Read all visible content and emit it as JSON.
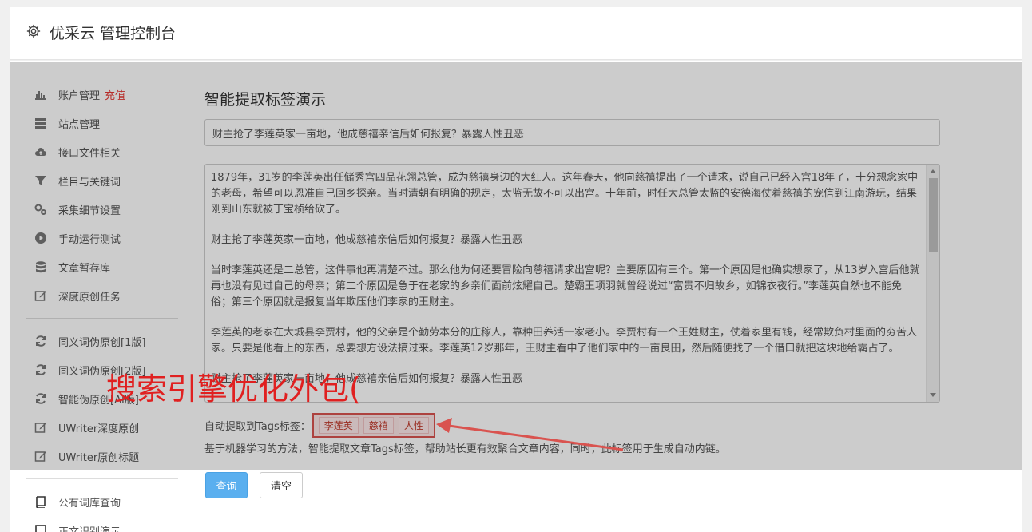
{
  "header": {
    "title": "优采云 管理控制台",
    "icon": "gear-icon"
  },
  "sidebar": {
    "items": [
      {
        "label": "账户管理",
        "badge": "充值",
        "icon": "bar-chart-icon"
      },
      {
        "label": "站点管理",
        "icon": "list-icon"
      },
      {
        "label": "接口文件相关",
        "icon": "cloud-upload-icon"
      },
      {
        "label": "栏目与关键词",
        "icon": "filter-icon"
      },
      {
        "label": "采集细节设置",
        "icon": "gears-icon"
      },
      {
        "label": "手动运行测试",
        "icon": "play-circle-icon"
      },
      {
        "label": "文章暂存库",
        "icon": "database-icon"
      },
      {
        "label": "深度原创任务",
        "icon": "edit-icon"
      },
      {
        "label": "同义词伪原创[1版]",
        "icon": "refresh-icon"
      },
      {
        "label": "同义词伪原创[2版]",
        "icon": "refresh-icon"
      },
      {
        "label": "智能伪原创[AI版]",
        "icon": "refresh-icon"
      },
      {
        "label": "UWriter深度原创",
        "icon": "edit-icon"
      },
      {
        "label": "UWriter原创标题",
        "icon": "edit-icon"
      },
      {
        "label": "公有词库查询",
        "icon": "book-icon"
      },
      {
        "label": "正文识别演示",
        "icon": "square-icon"
      }
    ]
  },
  "main": {
    "title": "智能提取标签演示",
    "input_value": "财主抢了李莲英家一亩地，他成慈禧亲信后如何报复？暴露人性丑恶",
    "paragraphs": [
      "1879年，31岁的李莲英出任储秀宫四品花翎总管，成为慈禧身边的大红人。这年春天，他向慈禧提出了一个请求，说自己已经入宫18年了，十分想念家中的老母，希望可以恩准自己回乡探亲。当时清朝有明确的规定，太监无故不可以出宫。十年前，时任大总管太监的安德海仗着慈禧的宠信到江南游玩，结果刚到山东就被丁宝桢给砍了。",
      "财主抢了李莲英家一亩地，他成慈禧亲信后如何报复？暴露人性丑恶",
      "当时李莲英还是二总管，这件事他再清楚不过。那么他为何还要冒险向慈禧请求出宫呢？主要原因有三个。第一个原因是他确实想家了，从13岁入宫后他就再也没有见过自己的母亲；第二个原因是急于在老家的乡亲们面前炫耀自己。楚霸王项羽就曾经说过“富贵不归故乡，如锦衣夜行。”李莲英自然也不能免俗；第三个原因就是报复当年欺压他们李家的王财主。",
      "李莲英的老家在大城县李贾村，他的父亲是个勤劳本分的庄稼人，靠种田养活一家老小。李贾村有一个王姓财主，仗着家里有钱，经常欺负村里面的穷苦人家。只要是他看上的东西，总要想方设法搞过来。李莲英12岁那年，王财主看中了他们家中的一亩良田，然后随便找了一个借口就把这块地给霸占了。",
      "财主抢了李莲英家一亩地，他成慈禧亲信后如何报复？暴露人性丑恶"
    ],
    "tags_label": "自动提取到Tags标签：",
    "tags": [
      "李莲英",
      "慈禧",
      "人性"
    ],
    "description": "基于机器学习的方法，智能提取文章Tags标签，帮助站长更有效聚合文章内容，同时，此标签用于生成自动内链。",
    "query_button": "查询",
    "clear_button": "清空"
  },
  "watermark": "搜索引擎优化外包(",
  "colors": {
    "accent": "#5aafef",
    "badge": "#e53935",
    "annotation": "#d9534f"
  }
}
